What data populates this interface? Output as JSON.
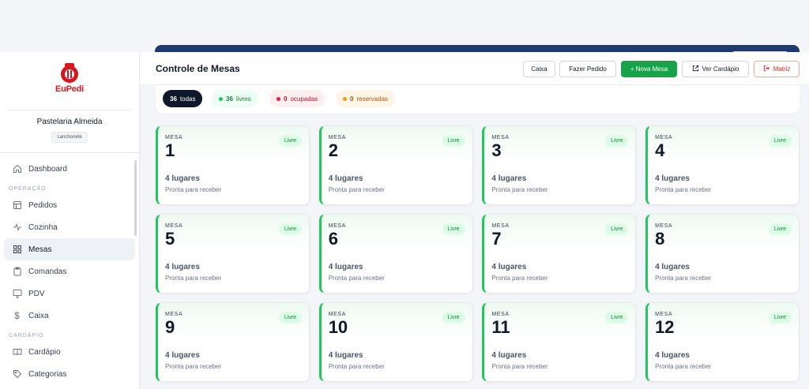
{
  "brand": {
    "name": "EuPedi",
    "accent": "#d4181f"
  },
  "store": {
    "name": "Pastelaria Almeida",
    "type": "Lanchonete"
  },
  "sidebar": {
    "items": [
      {
        "label": "Dashboard",
        "icon": "home-icon",
        "active": false
      },
      {
        "section": "OPERAÇÃO"
      },
      {
        "label": "Pedidos",
        "icon": "orders-icon",
        "active": false
      },
      {
        "label": "Cozinha",
        "icon": "activity-icon",
        "active": false
      },
      {
        "label": "Mesas",
        "icon": "grid-icon",
        "active": true
      },
      {
        "label": "Comandas",
        "icon": "clipboard-icon",
        "active": false
      },
      {
        "label": "PDV",
        "icon": "monitor-icon",
        "active": false
      },
      {
        "label": "Caixa",
        "icon": "dollar-icon",
        "active": false
      },
      {
        "section": "CARDÁPIO"
      },
      {
        "label": "Cardápio",
        "icon": "book-icon",
        "active": false
      },
      {
        "label": "Categorias",
        "icon": "tag-icon",
        "active": false
      }
    ]
  },
  "header": {
    "title": "Controle de Mesas",
    "buttons": {
      "caixa": "Caixa",
      "fazer_pedido": "Fazer Pedido",
      "nova_mesa": "+ Nova Mesa",
      "ver_cardapio": "Ver Cardápio",
      "matriz": "Matriz"
    }
  },
  "filters": {
    "all": {
      "count": "36",
      "label": "todas"
    },
    "livres": {
      "count": "36",
      "label": "livres",
      "color": "#22c55e"
    },
    "ocupadas": {
      "count": "0",
      "label": "ocupadas",
      "color": "#e11d48"
    },
    "reservadas": {
      "count": "0",
      "label": "reservadas",
      "color": "#f59e0b"
    }
  },
  "tables": [
    {
      "label": "MESA",
      "number": "1",
      "status": "Livre",
      "seats": "4 lugares",
      "note": "Pronta para receber"
    },
    {
      "label": "MESA",
      "number": "2",
      "status": "Livre",
      "seats": "4 lugares",
      "note": "Pronta para receber"
    },
    {
      "label": "MESA",
      "number": "3",
      "status": "Livre",
      "seats": "4 lugares",
      "note": "Pronta para receber"
    },
    {
      "label": "MESA",
      "number": "4",
      "status": "Livre",
      "seats": "4 lugares",
      "note": "Pronta para receber"
    },
    {
      "label": "MESA",
      "number": "5",
      "status": "Livre",
      "seats": "4 lugares",
      "note": "Pronta para receber"
    },
    {
      "label": "MESA",
      "number": "6",
      "status": "Livre",
      "seats": "4 lugares",
      "note": "Pronta para receber"
    },
    {
      "label": "MESA",
      "number": "7",
      "status": "Livre",
      "seats": "4 lugares",
      "note": "Pronta para receber"
    },
    {
      "label": "MESA",
      "number": "8",
      "status": "Livre",
      "seats": "4 lugares",
      "note": "Pronta para receber"
    },
    {
      "label": "MESA",
      "number": "9",
      "status": "Livre",
      "seats": "4 lugares",
      "note": "Pronta para receber"
    },
    {
      "label": "MESA",
      "number": "10",
      "status": "Livre",
      "seats": "4 lugares",
      "note": "Pronta para receber"
    },
    {
      "label": "MESA",
      "number": "11",
      "status": "Livre",
      "seats": "4 lugares",
      "note": "Pronta para receber"
    },
    {
      "label": "MESA",
      "number": "12",
      "status": "Livre",
      "seats": "4 lugares",
      "note": "Pronta para receber"
    }
  ]
}
